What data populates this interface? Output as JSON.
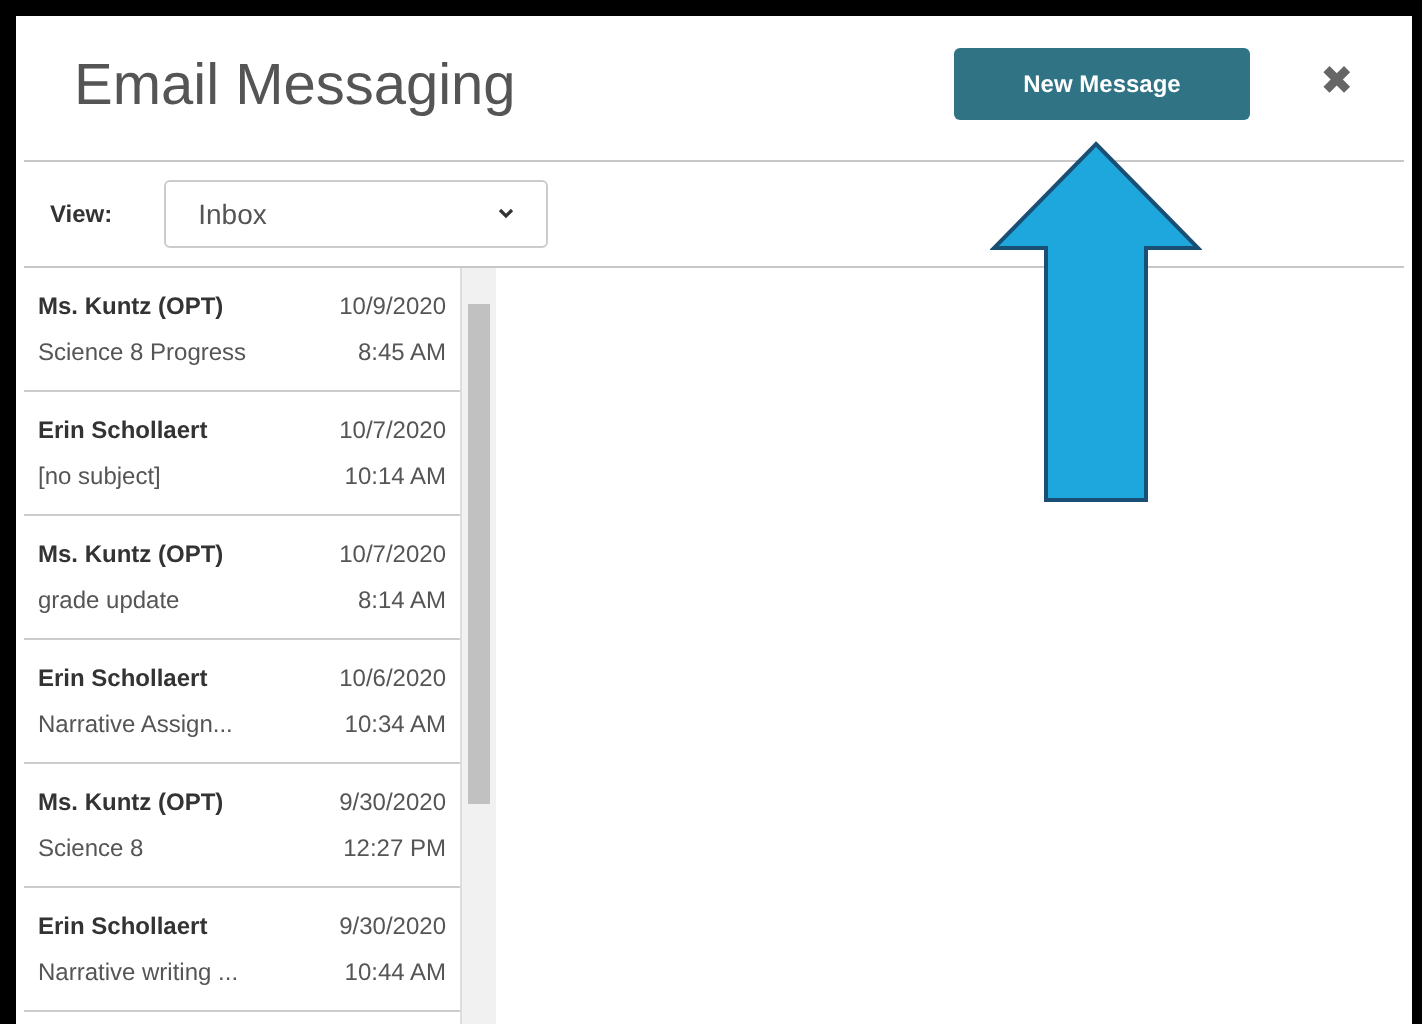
{
  "title": "Email Messaging",
  "new_message_button": "New Message",
  "close_button": "✖",
  "view": {
    "label": "View:",
    "value": "Inbox"
  },
  "messages": [
    {
      "sender": "Ms. Kuntz (OPT)",
      "date": "10/9/2020",
      "subject": "Science 8 Progress",
      "time": "8:45 AM"
    },
    {
      "sender": "Erin Schollaert",
      "date": "10/7/2020",
      "subject": "[no subject]",
      "time": "10:14 AM"
    },
    {
      "sender": "Ms. Kuntz (OPT)",
      "date": "10/7/2020",
      "subject": "grade update",
      "time": "8:14 AM"
    },
    {
      "sender": "Erin Schollaert",
      "date": "10/6/2020",
      "subject": "Narrative Assign...",
      "time": "10:34 AM"
    },
    {
      "sender": "Ms. Kuntz (OPT)",
      "date": "9/30/2020",
      "subject": "Science 8",
      "time": "12:27 PM"
    },
    {
      "sender": "Erin Schollaert",
      "date": "9/30/2020",
      "subject": "Narrative writing ...",
      "time": "10:44 AM"
    }
  ]
}
